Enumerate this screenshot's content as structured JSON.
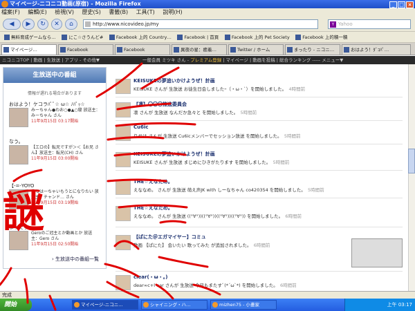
{
  "window": {
    "title": "マイページ-ニコニコ動画(原宿) - Mozilla Firefox",
    "buttons": [
      "_",
      "□",
      "×"
    ]
  },
  "menu": [
    "檔案(F)",
    "編輯(E)",
    "檢視(V)",
    "歷史(S)",
    "書籤(B)",
    "工具(T)",
    "說明(H)"
  ],
  "nav": {
    "back": "◀",
    "forward": "▶",
    "reload": "↻",
    "stop": "✕",
    "home": "⌂",
    "url": "http://www.nicovideo.jp/my",
    "search_placeholder": "Yahoo"
  },
  "bookmarks": [
    "無料育成ゲームなら…",
    "にこ☆さうんど#",
    "Facebook 上的 Country…",
    "Facebook | 首頁",
    "Facebook 上的 Pet Society",
    "Facebook 上的積一積"
  ],
  "tabs": [
    "マイページ…",
    "Facebook",
    "Facebook",
    "異夜の星：癒着…",
    "Twitter / ホーム",
    "まったり - ニコニ…",
    "おはよう！ﾀﾞｺﾊﾟ…"
  ],
  "nicobar": {
    "left": "ニコニコTOP | 動画 | 生放送 | アプリ - その他▼",
    "right": "一般会員 ミツキ さん - ",
    "premium": "プレミアム登録",
    "after": " | マイページ | 動画を投稿 | 総合ランキング ----- メニュー▼"
  },
  "sidebar": {
    "heading": "生放送中の番組",
    "note": "情報が遅れる場合があります",
    "items": [
      {
        "title": "おはよう！ケコラﾊﾟﾟ☆ ω☆ ﾉﾊﾟｯ☆",
        "desc": "みーちゃん●わお○●▲○寝 放送主：みーちゃん さん",
        "time": "11年9月15日 03:17開始"
      },
      {
        "title": "なう。",
        "desc": "【エロの】転兄ですが＞＜【お兄 さん】放送主：転兄(CH) さん",
        "time": "11年9月15日 03:00開始"
      },
      {
        "title": "【-=-YOYO",
        "desc": "うちは一ちゃいもうとになりたい 放送主：チャンド… さん",
        "time": "11年9月15日 03:19開始"
      },
      {
        "title": "まったり",
        "desc": "Geroのご冠主とか動画とか 放送主：Gero さん",
        "time": "11年9月15日 02:50開始"
      }
    ],
    "more": "› 生放送中の番組一覧"
  },
  "feed": [
    {
      "title": "KEISUKEの夢追いかけようぜ！計画",
      "text": "KEISUKE さんが 生放送 お徒生日会しましたｰ（・ω・`）を開始しました。",
      "time": "4時間前"
    },
    {
      "title": "【凛】〇〇〇推進委員会",
      "text": "凛 さんが 生放送 なんだか急々と を開始しました。",
      "time": "5時間前"
    },
    {
      "title": "Cu6ic",
      "text": "りせは さんが 生放送 Cu6icメンバーでセッション放送 を開始しました。",
      "time": "5時間前"
    },
    {
      "title": "KEISUKEの夢追いかけようぜ！計画",
      "text": "KEISUKE さんが 生放送 まじめにひきがたります を開始しました。",
      "time": "5時間前"
    },
    {
      "title": "THE☆えなため。",
      "text": "えななめ。 さんが 生放送 萌え声JK with しーなちゃん co420354 を開始しました。",
      "time": "5時間前"
    },
    {
      "title": "THE☆えなため。",
      "text": "えななめ。 さんが 生放送 ((°∀°))((°∀°))((°∀°))((°∀°)) を開始しました。",
      "time": "6時間前"
    },
    {
      "title": "【ぱにた＠エガマイヤー】コミュ",
      "text": "動画 【ぱにた】 会いたい 歌ってみた が追加されました。",
      "time": "6時間前"
    },
    {
      "title": "clear(・ω・｡)",
      "text": "dear∞c+l ear さんが 生放送 今日もまたすﾞ(*´ω`*) を開始しました。",
      "time": "6時間前"
    }
  ],
  "scribble_text": "謎",
  "status": "完成",
  "taskbar": {
    "start": "開始",
    "tasks": [
      "マイページ-ニコニ…",
      "シャイニング・ハ…",
      "mizhen75 - 小畫家"
    ],
    "clock": "上午 03:17"
  }
}
